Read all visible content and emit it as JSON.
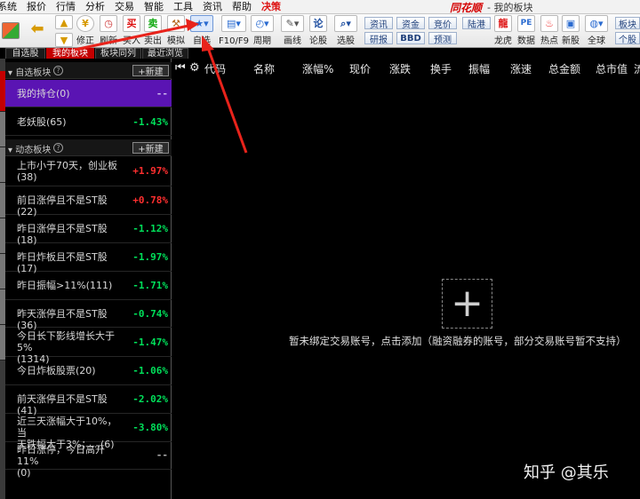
{
  "menubar": {
    "items": [
      "系统",
      "报价",
      "行情",
      "分析",
      "交易",
      "智能",
      "工具",
      "资讯",
      "帮助",
      "决策"
    ],
    "app_logo": "同花顺",
    "window_title": "- 我的板块"
  },
  "toolbar": {
    "buttons": [
      {
        "label": "",
        "icon": "grid-icon"
      },
      {
        "label": "",
        "icon": "back-arrow-icon"
      },
      {
        "label": "",
        "icon": "up-arrow-icon"
      },
      {
        "label": "修正",
        "icon": "coin-icon"
      },
      {
        "label": "刷新",
        "icon": "clock-icon"
      },
      {
        "label": "买入",
        "icon": "buy-icon",
        "glyph": "买"
      },
      {
        "label": "卖出",
        "icon": "sell-icon",
        "glyph": "卖"
      },
      {
        "label": "模拟",
        "icon": "hammer-icon"
      },
      {
        "label": "自选",
        "icon": "star-folder-icon"
      },
      {
        "label": "F10/F9",
        "icon": "report-icon"
      },
      {
        "label": "周期",
        "icon": "period-icon"
      },
      {
        "label": "画线",
        "icon": "pen-icon"
      },
      {
        "label": "论股",
        "icon": "forum-icon",
        "glyph": "论"
      },
      {
        "label": "选股",
        "icon": "magnifier-icon"
      },
      {
        "label": "龙虎",
        "icon": "dragon-icon"
      },
      {
        "label": "数据",
        "icon": "data-icon",
        "glyph": "PE"
      },
      {
        "label": "热点",
        "icon": "flame-icon"
      },
      {
        "label": "新股",
        "icon": "new-stock-icon"
      },
      {
        "label": "全球",
        "icon": "globe-icon"
      }
    ],
    "small_buttons": {
      "news": "资讯",
      "research": "研报",
      "funds": "资金",
      "bbd": "BBD",
      "auction": "竞价",
      "forecast": "预测",
      "hkconnect": "陆港",
      "sector": "板块",
      "personal": "个股"
    }
  },
  "subtabs": [
    "自选股",
    "我的板块",
    "板块同列",
    "最近浏览"
  ],
  "left_panel": {
    "custom_section": {
      "label": "自选板块",
      "new_button": "+新建",
      "items": [
        {
          "name": "我的持仓(0)",
          "value": "--",
          "dir": "flat",
          "active": true
        },
        {
          "name": "老妖股(65)",
          "value": "-1.43%",
          "dir": "down"
        }
      ]
    },
    "dynamic_section": {
      "label": "动态板块",
      "new_button": "+新建",
      "items": [
        {
          "name": "上市小于70天，创业板\n(38)",
          "value": "+1.97%",
          "dir": "up"
        },
        {
          "name": "前日涨停且不是ST股(22)",
          "value": "+0.78%",
          "dir": "up"
        },
        {
          "name": "昨日涨停且不是ST股(18)",
          "value": "-1.12%",
          "dir": "down"
        },
        {
          "name": "昨日炸板且不是ST股(17)",
          "value": "-1.97%",
          "dir": "down"
        },
        {
          "name": "昨日振幅>11%(111)",
          "value": "-1.71%",
          "dir": "down"
        },
        {
          "name": "昨天涨停且不是ST股(36)",
          "value": "-0.74%",
          "dir": "down"
        },
        {
          "name": "今日长下影线增长大于5%\n(1314)",
          "value": "-1.47%",
          "dir": "down"
        },
        {
          "name": "今日炸板股票(20)",
          "value": "-1.06%",
          "dir": "down"
        },
        {
          "name": "前天涨停且不是ST股(41)",
          "value": "-2.02%",
          "dir": "down"
        },
        {
          "name": "近三天涨幅大于10%，当\n天跌幅大于3%；...(6)",
          "value": "-3.80%",
          "dir": "down"
        },
        {
          "name": "昨日涨停，今日高开11%\n(0)",
          "value": "--",
          "dir": "flat"
        }
      ]
    }
  },
  "main": {
    "columns": [
      "代码",
      "名称",
      "涨幅%",
      "现价",
      "涨跌",
      "换手",
      "振幅",
      "涨速",
      "总金额",
      "总市值",
      "流"
    ],
    "empty_message": "暂未绑定交易账号，点击添加（融资融券的账号，部分交易账号暂不支持）",
    "add_glyph": "+",
    "watermark": "知乎 @其乐"
  },
  "colors": {
    "accent_red": "#c40000",
    "active_row": "#5a14b3",
    "up": "#ff2f2f",
    "down": "#00e05a",
    "annotation_arrow": "#e8231b"
  }
}
